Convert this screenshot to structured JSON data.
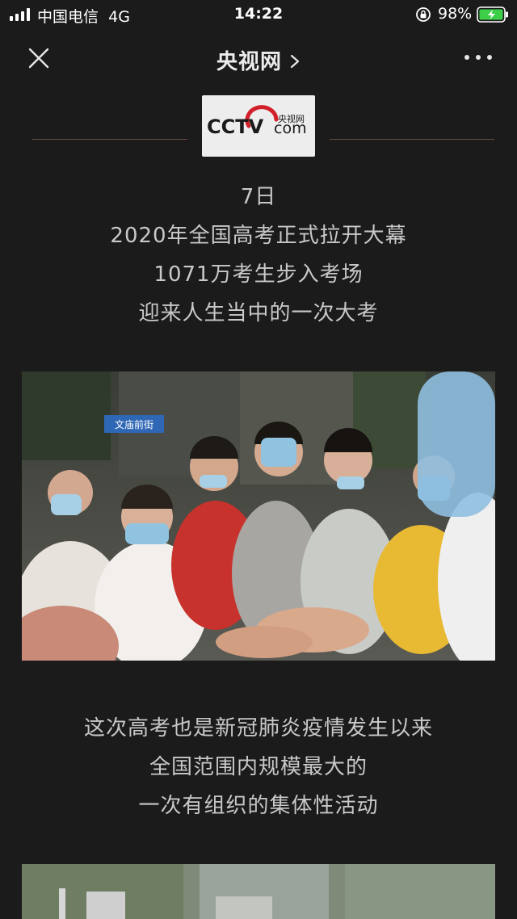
{
  "status_bar": {
    "carrier": "中国电信",
    "network": "4G",
    "time": "14:22",
    "battery": "98%"
  },
  "nav": {
    "title": "央视网"
  },
  "logo": {
    "brand": "CCTV",
    "suffix": "com",
    "chinese": "央视网"
  },
  "article": {
    "intro_lines": [
      "7日",
      "2020年全国高考正式拉开大幕",
      "1071万考生步入考场",
      "迎来人生当中的一次大考"
    ],
    "photo1": {
      "sign_text": "文庙前街"
    },
    "body_lines": [
      "这次高考也是新冠肺炎疫情发生以来",
      "全国范围内规模最大的",
      "一次有组织的集体性活动"
    ]
  },
  "colors": {
    "background": "#1b1b1b",
    "text": "#c8c8c8",
    "divider": "#6e4a3c",
    "logo_red": "#d2202a",
    "battery_green": "#3ecf4a"
  },
  "icons": [
    "signal-icon",
    "lock-rotation-icon",
    "battery-charging-icon",
    "close-icon",
    "chevron-right-icon",
    "more-icon"
  ]
}
